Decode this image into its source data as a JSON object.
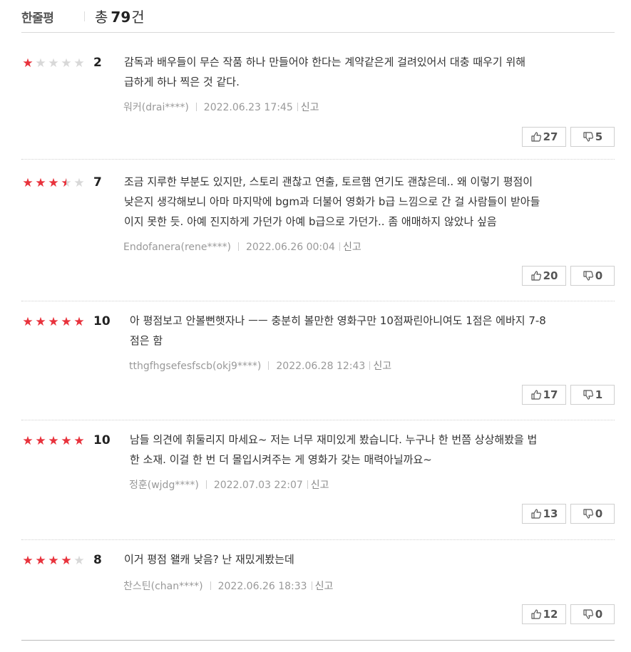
{
  "header": {
    "title": "한줄평",
    "total_prefix": "총",
    "total_count": "79",
    "total_unit": "건"
  },
  "colors": {
    "star_on": "#e8323c",
    "star_off": "#d8d8d8"
  },
  "reviews": [
    {
      "rating": 1,
      "score": "2",
      "text": "감독과 배우들이 무슨 작품 하나 만들어야 한다는 계약같은게 걸려있어서 대충 때우기 위해\n급하게 하나 찍은 것 같다.",
      "author": "워커(drai****)",
      "date": "2022.06.23 17:45",
      "report": "신고",
      "likes": "27",
      "dislikes": "5"
    },
    {
      "rating": 3.5,
      "score": "7",
      "text": "조금 지루한 부분도 있지만, 스토리 괜찮고 연출, 토르햄 연기도 괜찮은데.. 왜 이렇기 평점이\n낮은지 생각해보니 아마 마지막에 bgm과 더불어 영화가 b급 느낌으로 간 걸 사람들이 받아들\n이지 못한 듯. 아예 진지하게 가던가 아예 b급으로 가던가.. 좀 애매하지 않았나 싶음",
      "author": "Endofanera(rene****)",
      "date": "2022.06.26 00:04",
      "report": "신고",
      "likes": "20",
      "dislikes": "0"
    },
    {
      "rating": 5,
      "score": "10",
      "text": "아 평점보고 안볼뻔햇자나 ㅡㅡ 충분히 볼만한 영화구만 10점짜린아니여도 1점은 에바지 7-8\n점은 함",
      "author": "tthgfhgsefesfscb(okj9****)",
      "date": "2022.06.28 12:43",
      "report": "신고",
      "likes": "17",
      "dislikes": "1"
    },
    {
      "rating": 5,
      "score": "10",
      "text": "남들 의견에 휘둘리지 마세요~ 저는 너무 재미있게 봤습니다. 누구나 한 번쯤 상상해봤을 법\n한 소재. 이걸 한 번 더 몰입시켜주는 게 영화가 갖는 매력아닐까요~",
      "author": "정훈(wjdg****)",
      "date": "2022.07.03 22:07",
      "report": "신고",
      "likes": "13",
      "dislikes": "0"
    },
    {
      "rating": 4,
      "score": "8",
      "text": "이거 평점 왤캐 낮음? 난 재밌게봤는데",
      "author": "찬스틴(chan****)",
      "date": "2022.06.26 18:33",
      "report": "신고",
      "likes": "12",
      "dislikes": "0"
    }
  ]
}
